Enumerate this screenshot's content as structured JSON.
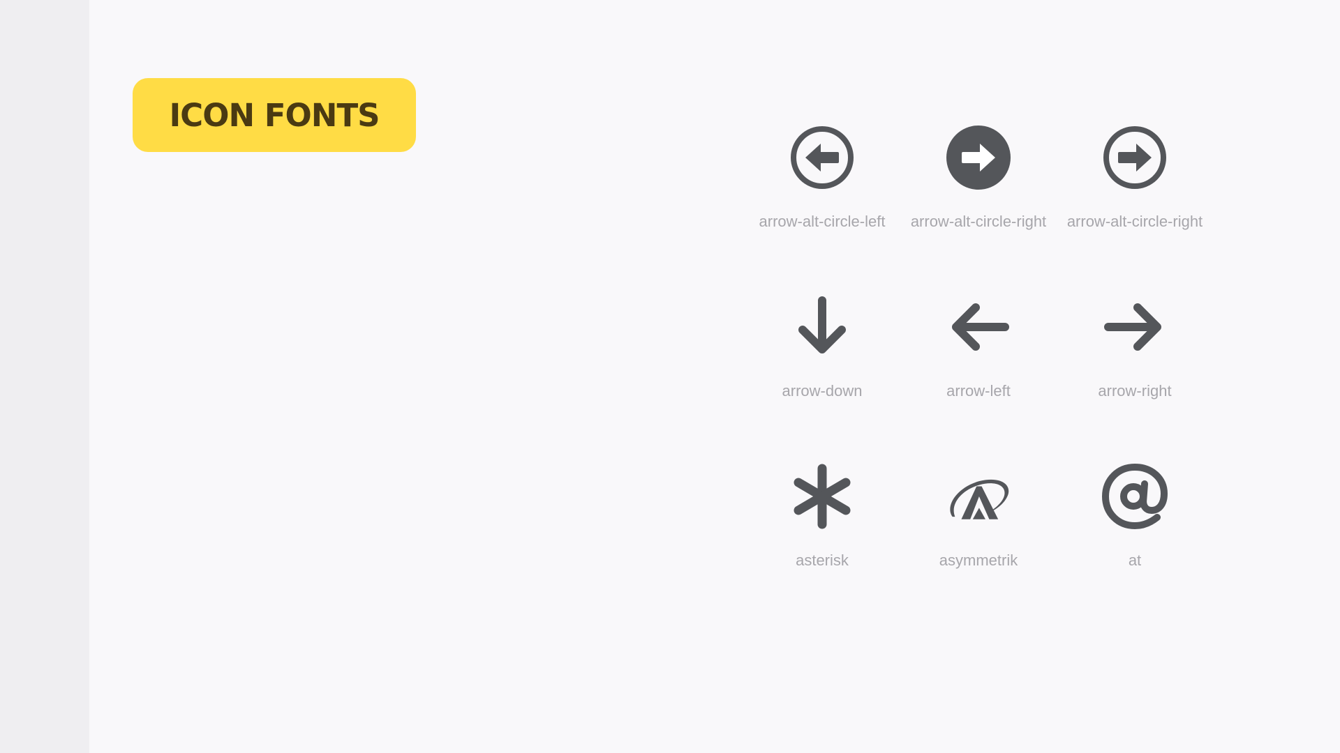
{
  "title": "ICON FONTS",
  "colors": {
    "background": "#f9f8fa",
    "side_strip": "#efeef1",
    "badge": "#ffdc45",
    "badge_text": "#4a3a12",
    "icon": "#54565a",
    "label": "#a7a6ab"
  },
  "icons": [
    {
      "name": "arrow-alt-circle-left-icon",
      "label": "arrow-alt-circle-left"
    },
    {
      "name": "arrow-alt-circle-right-solid-icon",
      "label": "arrow-alt-circle-right"
    },
    {
      "name": "arrow-alt-circle-right-outline-icon",
      "label": "arrow-alt-circle-right"
    },
    {
      "name": "arrow-down-icon",
      "label": "arrow-down"
    },
    {
      "name": "arrow-left-icon",
      "label": "arrow-left"
    },
    {
      "name": "arrow-right-icon",
      "label": "arrow-right"
    },
    {
      "name": "asterisk-icon",
      "label": "asterisk"
    },
    {
      "name": "asymmetrik-icon",
      "label": "asymmetrik"
    },
    {
      "name": "at-icon",
      "label": "at"
    }
  ]
}
